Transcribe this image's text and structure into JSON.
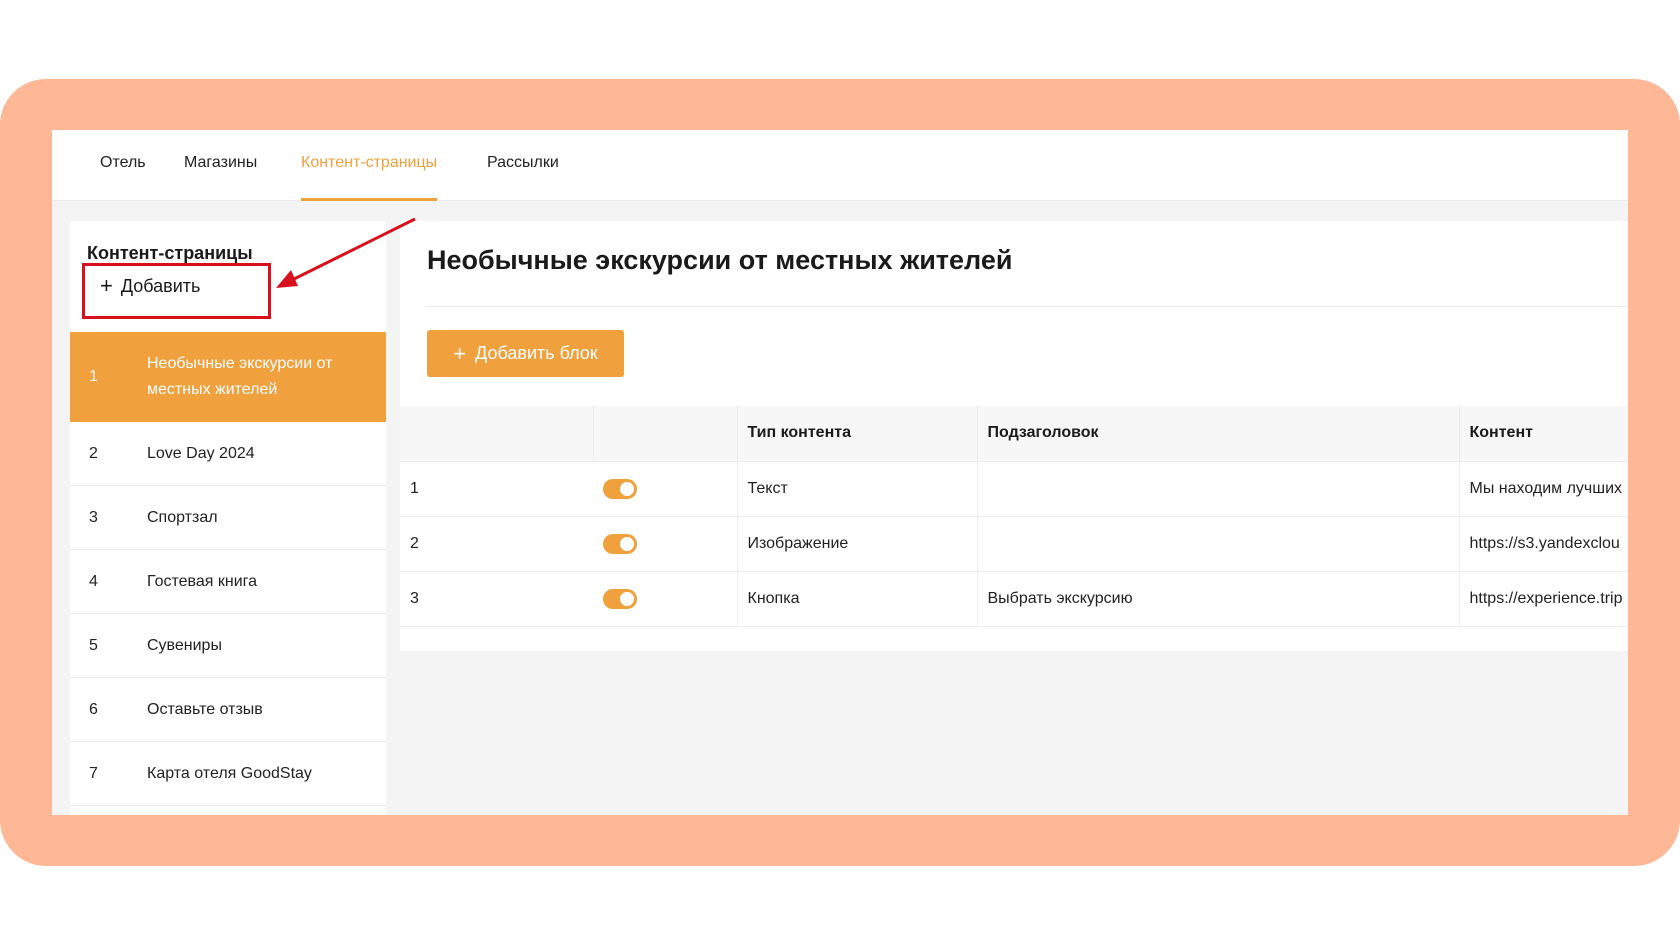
{
  "nav": {
    "tabs": [
      {
        "label": "Отель"
      },
      {
        "label": "Магазины"
      },
      {
        "label": "Контент-страницы",
        "active": true
      },
      {
        "label": "Рассылки"
      }
    ]
  },
  "sidebar": {
    "title": "Контент-страницы",
    "add_label": "Добавить",
    "items": [
      {
        "num": "1",
        "title": "Необычные экскурсии от местных жителей",
        "active": true
      },
      {
        "num": "2",
        "title": "Love Day 2024"
      },
      {
        "num": "3",
        "title": "Спортзал"
      },
      {
        "num": "4",
        "title": "Гостевая книга"
      },
      {
        "num": "5",
        "title": "Сувениры"
      },
      {
        "num": "6",
        "title": "Оставьте отзыв"
      },
      {
        "num": "7",
        "title": "Карта отеля GoodStay"
      }
    ]
  },
  "main": {
    "title": "Необычные экскурсии от местных жителей",
    "add_block_label": "Добавить блок",
    "table": {
      "headers": [
        "",
        "",
        "Тип контента",
        "Подзаголовок",
        "Контент"
      ],
      "rows": [
        {
          "num": "1",
          "enabled": true,
          "type": "Текст",
          "subtitle": "",
          "content": "Мы находим лучших"
        },
        {
          "num": "2",
          "enabled": true,
          "type": "Изображение",
          "subtitle": "",
          "content": "https://s3.yandexclou"
        },
        {
          "num": "3",
          "enabled": true,
          "type": "Кнопка",
          "subtitle": "Выбрать экскурсию",
          "content": "https://experience.trip"
        }
      ]
    }
  },
  "colors": {
    "accent": "#f0a03d",
    "frame": "#ffb896",
    "annotation_red": "#d8101e"
  }
}
